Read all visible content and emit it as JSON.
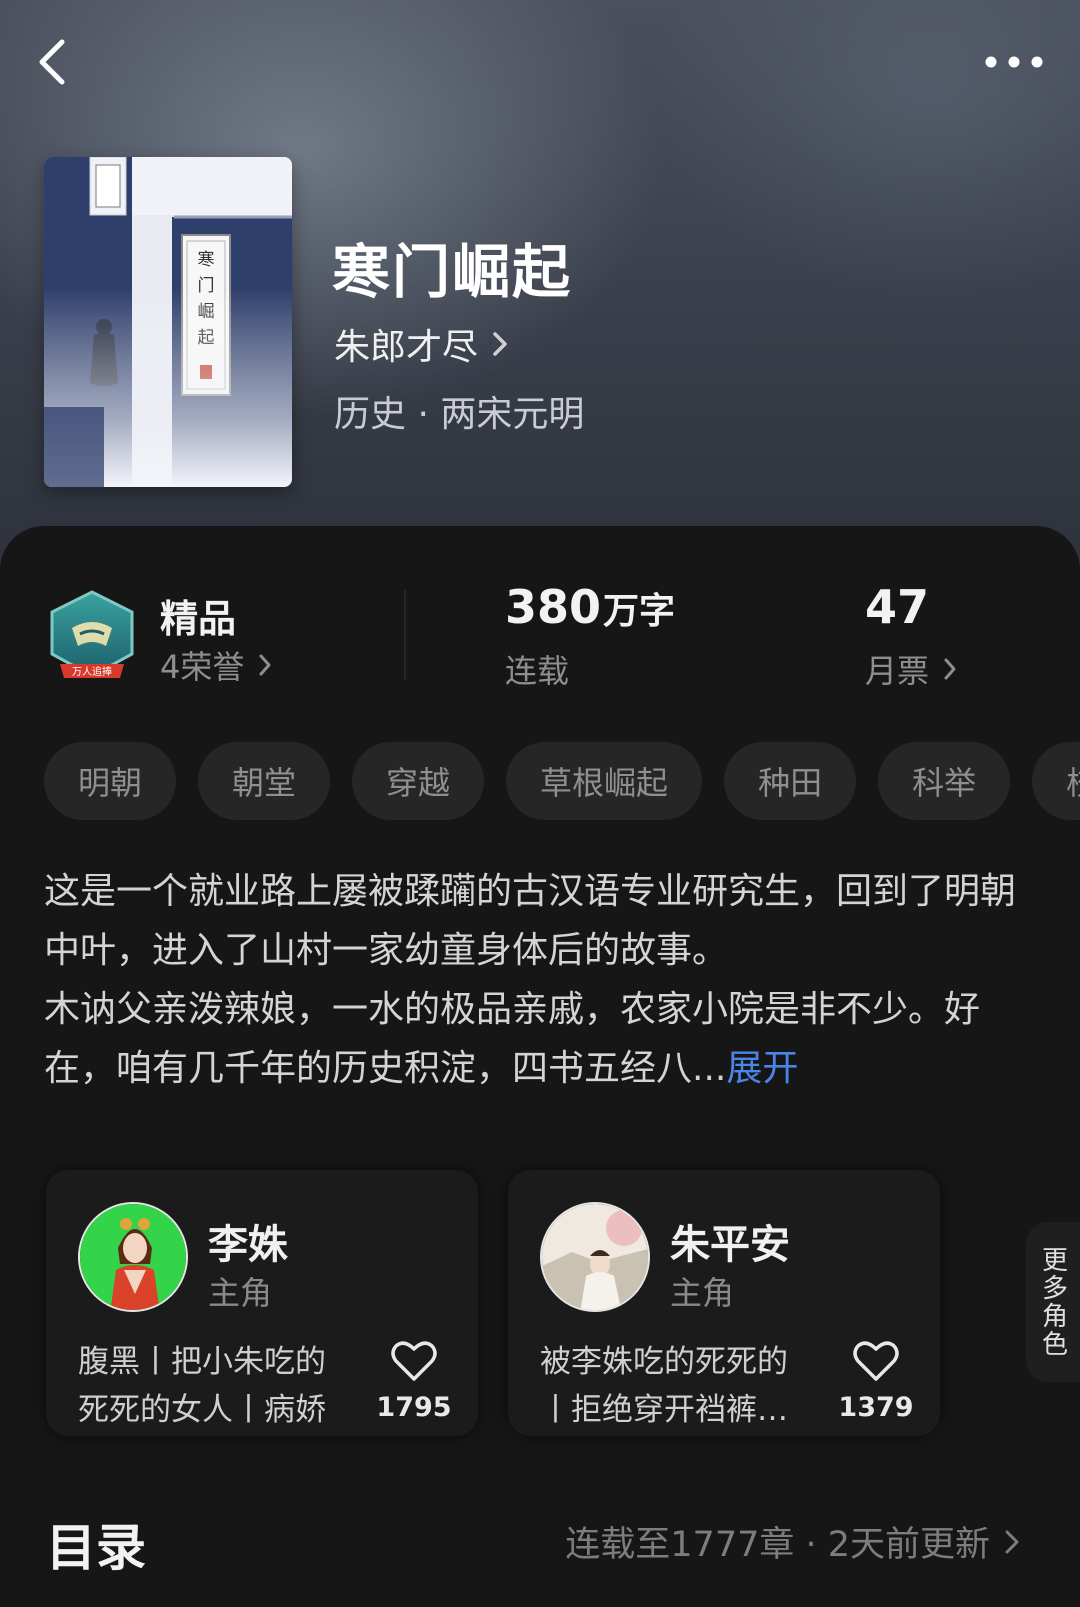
{
  "book": {
    "title": "寒门崛起",
    "author": "朱郎才尽",
    "genre": "历史 · 两宋元明",
    "cover_title_text": "寒门崛起"
  },
  "stats": {
    "premium_label": "精品",
    "honors_label": "4荣誉",
    "badge_text": "万人追捧",
    "word_count_number": "380",
    "word_count_unit": "万字",
    "status": "连载",
    "monthly_votes": "47",
    "monthly_votes_label": "月票"
  },
  "tags": [
    "明朝",
    "朝堂",
    "穿越",
    "草根崛起",
    "种田",
    "科举",
    "校"
  ],
  "description": {
    "text": "这是一个就业路上屡被蹂躏的古汉语专业研究生，回到了明朝中叶，进入了山村一家幼童身体后的故事。\n木讷父亲泼辣娘，一水的极品亲戚，农家小院是非不少。好在，咱有几千年的历史积淀，四书五经八...",
    "expand_label": "展开"
  },
  "characters": [
    {
      "name": "李姝",
      "role": "主角",
      "desc": "腹黑丨把小朱吃的死死的女人丨病娇",
      "likes": "1795"
    },
    {
      "name": "朱平安",
      "role": "主角",
      "desc": "被李姝吃的死死的丨拒绝穿开裆裤的男人",
      "likes": "1379"
    }
  ],
  "more_roles_label": "更多角色",
  "toc": {
    "title": "目录",
    "meta": "连载至1777章 · 2天前更新"
  },
  "colors": {
    "accent_link": "#4a86e8",
    "panel_bg": "#161616",
    "tag_bg": "#262626"
  },
  "icons": {
    "back": "back-arrow-icon",
    "more": "more-dots-icon",
    "chevron": "chevron-right-icon",
    "heart": "heart-icon"
  }
}
